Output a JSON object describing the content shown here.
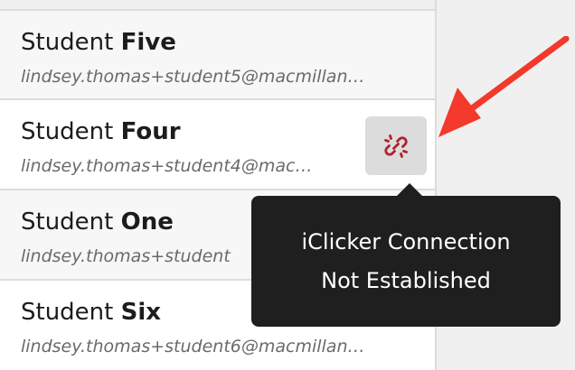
{
  "students": [
    {
      "first": "Student",
      "last": "Five",
      "email": "lindsey.thomas+student5@macmillan…"
    },
    {
      "first": "Student",
      "last": "Four",
      "email": "lindsey.thomas+student4@mac…"
    },
    {
      "first": "Student",
      "last": "One",
      "email": "lindsey.thomas+student"
    },
    {
      "first": "Student",
      "last": "Six",
      "email": "lindsey.thomas+student6@macmillan…"
    }
  ],
  "tooltip": {
    "line1": "iClicker Connection",
    "line2": "Not Established"
  },
  "icons": {
    "link_status": "broken-link-icon",
    "annotation": "red-arrow-icon"
  },
  "colors": {
    "broken_link": "#b0222d",
    "annotation_arrow": "#f2392b",
    "tooltip_bg": "#1f1f1f"
  }
}
